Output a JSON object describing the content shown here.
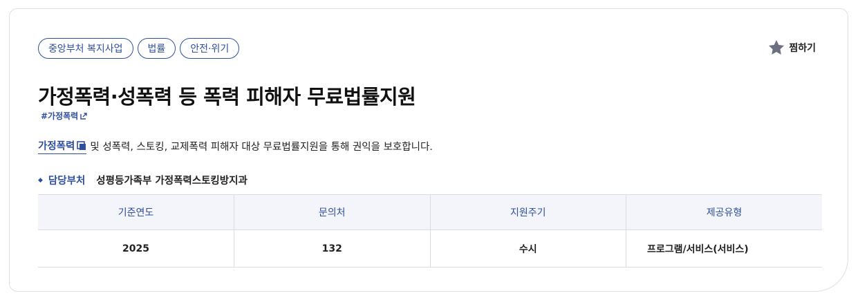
{
  "tags": [
    "중앙부처 복지사업",
    "법률",
    "안전·위기"
  ],
  "favorite": {
    "label": "찜하기",
    "icon": "star-icon",
    "icon_color": "#6b6f7f"
  },
  "title": "가정폭력·성폭력 등 폭력 피해자 무료법률지원",
  "hashtag": {
    "text": "#가정폭력",
    "icon": "external-link-icon"
  },
  "description": {
    "link_text": "가정폭력",
    "link_icon": "dictionary-icon",
    "text": "및 성폭력, 스토킹, 교제폭력 피해자 대상 무료법률지원을 통해 권익을 보호합니다."
  },
  "department": {
    "label": "담당부처",
    "value": "성평등가족부 가정폭력스토킹방지과"
  },
  "table": {
    "headers": [
      "기준연도",
      "문의처",
      "지원주기",
      "제공유형"
    ],
    "row": [
      "2025",
      "132",
      "수시",
      "프로그램/서비스(서비스)"
    ]
  },
  "colors": {
    "accent": "#2e4e9e",
    "header_bg": "#f3f5fa",
    "border": "#d7dce6"
  }
}
